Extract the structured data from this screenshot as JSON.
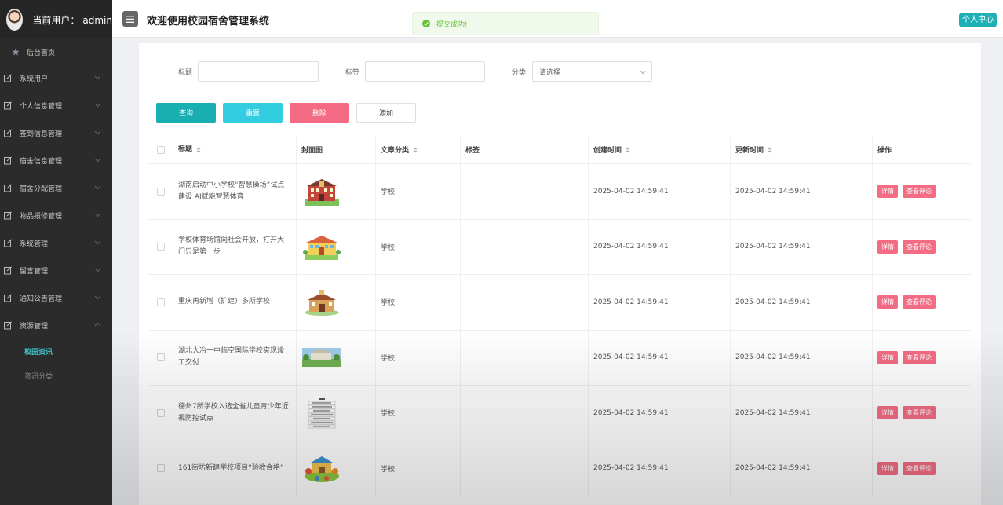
{
  "user": {
    "label": "当前用户：",
    "name": "admin"
  },
  "sidebar": {
    "home": "后台首页",
    "items": [
      {
        "label": "系统用户"
      },
      {
        "label": "个人信息管理"
      },
      {
        "label": "签到信息管理"
      },
      {
        "label": "宿舍信息管理"
      },
      {
        "label": "宿舍分配管理"
      },
      {
        "label": "物品报修管理"
      },
      {
        "label": "系统管理"
      },
      {
        "label": "留言管理"
      },
      {
        "label": "通知公告管理"
      },
      {
        "label": "资源管理"
      }
    ],
    "submenu": [
      {
        "label": "校园资讯"
      },
      {
        "label": "资讯分类"
      }
    ]
  },
  "header": {
    "title": "欢迎使用校园宿舍管理系统",
    "toast": "提交成功!",
    "profile": "个人中心"
  },
  "filters": {
    "title_label": "标题",
    "tag_label": "标签",
    "category_label": "分类",
    "category_value": "请选择"
  },
  "actions": {
    "query": "查询",
    "reset": "重置",
    "delete": "删除",
    "add": "添加"
  },
  "table": {
    "headers": {
      "title": "标题",
      "cover": "封面图",
      "category": "文章分类",
      "tag": "标签",
      "created": "创建时间",
      "updated": "更新时间",
      "ops": "操作"
    },
    "detail_label": "详情",
    "comment_label": "查看评论",
    "rows": [
      {
        "title": "湖南启动中小学校“智慧操场”试点建设 AI赋能智慧体育",
        "category": "学校",
        "created": "2025-04-02 14:59:41",
        "updated": "2025-04-02 14:59:41",
        "thumb": "school-red"
      },
      {
        "title": "学校体育场馆向社会开放，打开大门只是第一步",
        "category": "学校",
        "created": "2025-04-02 14:59:41",
        "updated": "2025-04-02 14:59:41",
        "thumb": "school-yellow"
      },
      {
        "title": "重庆再新增（扩建）多所学校",
        "category": "学校",
        "created": "2025-04-02 14:59:41",
        "updated": "2025-04-02 14:59:41",
        "thumb": "school-brown"
      },
      {
        "title": "湖北大冶一中临空国际学校实现竣工交付",
        "category": "学校",
        "created": "2025-04-02 14:59:41",
        "updated": "2025-04-02 14:59:41",
        "thumb": "campus-photo"
      },
      {
        "title": "德州7所学校入选全省儿童青少年近视防控试点",
        "category": "学校",
        "created": "2025-04-02 14:59:41",
        "updated": "2025-04-02 14:59:41",
        "thumb": "text-list"
      },
      {
        "title": "161街坊新建学校项目“验收合格”",
        "category": "学校",
        "created": "2025-04-02 14:59:41",
        "updated": "2025-04-02 14:59:41",
        "thumb": "kids-cartoon"
      }
    ]
  }
}
